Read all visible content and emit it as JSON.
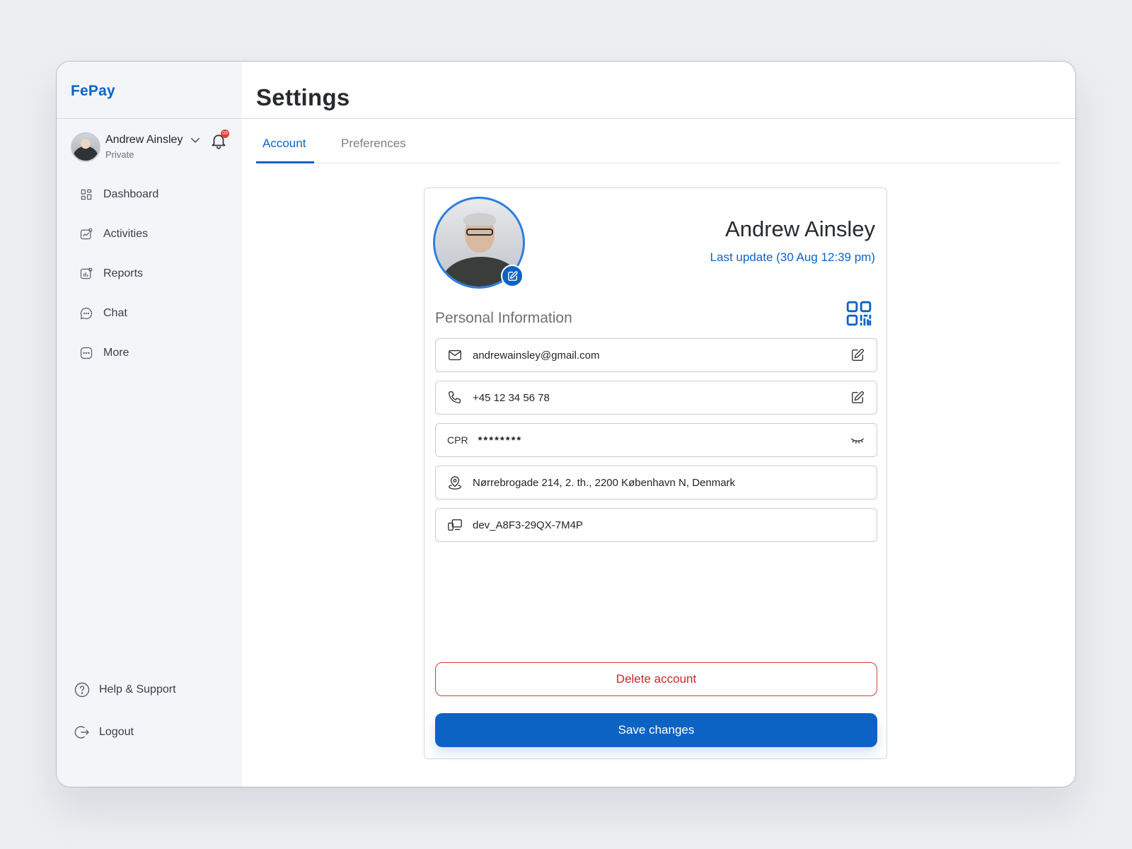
{
  "app": {
    "logo": "FePay"
  },
  "user": {
    "name": "Andrew Ainsley",
    "account_type": "Private",
    "notification_count": "03"
  },
  "sidebar": {
    "items": [
      {
        "label": "Dashboard",
        "icon": "grid-icon"
      },
      {
        "label": "Activities",
        "icon": "activity-chart-icon"
      },
      {
        "label": "Reports",
        "icon": "report-icon"
      },
      {
        "label": "Chat",
        "icon": "chat-bubble-icon"
      },
      {
        "label": "More",
        "icon": "more-dots-icon"
      }
    ],
    "bottom_items": [
      {
        "label": "Help & Support",
        "icon": "help-circle-icon"
      },
      {
        "label": "Logout",
        "icon": "logout-icon"
      }
    ]
  },
  "header": {
    "title": "Settings"
  },
  "tabs": [
    {
      "label": "Account",
      "active": true
    },
    {
      "label": "Preferences",
      "active": false
    }
  ],
  "profile": {
    "name": "Andrew Ainsley",
    "last_update": "Last update (30 Aug 12:39 pm)"
  },
  "personal_info": {
    "title": "Personal Information",
    "fields": [
      {
        "icon": "mail-icon",
        "value": "andrewainsley@gmail.com",
        "action": "edit-icon"
      },
      {
        "icon": "phone-icon",
        "value": "+45 12 34 56 78",
        "action": "edit-icon"
      },
      {
        "label": "CPR",
        "value": "********",
        "action": "eye-closed-icon"
      },
      {
        "icon": "location-pin-icon",
        "value": "Nørrebrogade 214, 2. th., 2200 København N, Denmark"
      },
      {
        "icon": "devices-icon",
        "value": "dev_A8F3-29QX-7M4P"
      }
    ]
  },
  "actions": {
    "delete_label": "Delete account",
    "save_label": "Save changes"
  },
  "colors": {
    "accent": "#0d63c4",
    "danger": "#d63c3c",
    "sidebar_bg": "#f3f5f8"
  }
}
